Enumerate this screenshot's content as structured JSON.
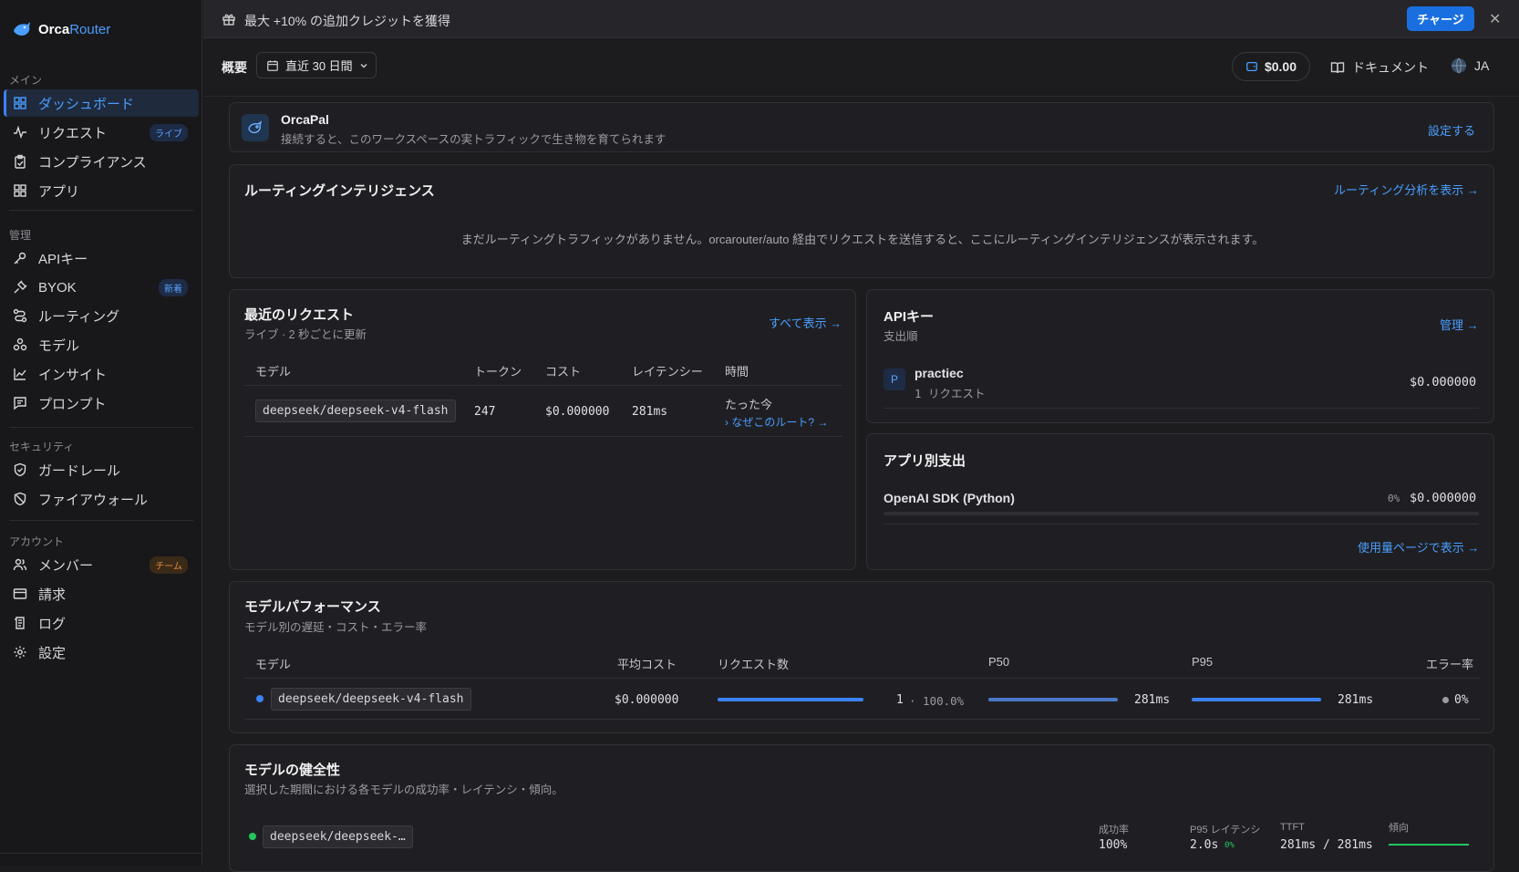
{
  "brand": {
    "name_a": "Orca",
    "name_b": "Router"
  },
  "sidebar": {
    "sections": {
      "main": "メイン",
      "manage": "管理",
      "security": "セキュリティ",
      "account": "アカウント"
    },
    "items": [
      {
        "label": "ダッシュボード",
        "icon": "grid-icon"
      },
      {
        "label": "リクエスト",
        "icon": "activity-icon",
        "badge": "ライブ"
      },
      {
        "label": "コンプライアンス",
        "icon": "clipboard-icon"
      },
      {
        "label": "アプリ",
        "icon": "apps-icon"
      },
      {
        "label": "APIキー",
        "icon": "key-icon"
      },
      {
        "label": "BYOK",
        "icon": "plug-icon",
        "badge": "新着"
      },
      {
        "label": "ルーティング",
        "icon": "route-icon"
      },
      {
        "label": "モデル",
        "icon": "models-icon"
      },
      {
        "label": "インサイト",
        "icon": "chart-icon"
      },
      {
        "label": "プロンプト",
        "icon": "message-icon"
      },
      {
        "label": "ガードレール",
        "icon": "shield-icon"
      },
      {
        "label": "ファイアウォール",
        "icon": "shield-off-icon"
      },
      {
        "label": "メンバー",
        "icon": "users-icon",
        "badge": "チーム"
      },
      {
        "label": "請求",
        "icon": "credit-card-icon"
      },
      {
        "label": "ログ",
        "icon": "log-icon"
      },
      {
        "label": "設定",
        "icon": "gear-icon"
      }
    ]
  },
  "banner": {
    "text": "最大 +10% の追加クレジットを獲得",
    "button": "チャージ"
  },
  "topbar": {
    "title": "概要",
    "date_range": "直近 30 日間",
    "balance": "$0.00",
    "docs": "ドキュメント",
    "lang": "JA"
  },
  "orcapal": {
    "title": "OrcaPal",
    "desc": "接続すると、このワークスペースの実トラフィックで生き物を育てられます",
    "action": "設定する"
  },
  "routing": {
    "title": "ルーティングインテリジェンス",
    "link": "ルーティング分析を表示 →",
    "empty": "まだルーティングトラフィックがありません。orcarouter/auto 経由でリクエストを送信すると、ここにルーティングインテリジェンスが表示されます。"
  },
  "recent": {
    "title": "最近のリクエスト",
    "sub": "ライブ · 2 秒ごとに更新",
    "link": "すべて表示 →",
    "headers": [
      "モデル",
      "トークン",
      "コスト",
      "レイテンシー",
      "時間"
    ],
    "rows": [
      {
        "model": "deepseek/deepseek-v4-flash",
        "tokens": "247",
        "cost": "$0.000000",
        "latency": "281ms",
        "time": "たった今",
        "why": "› なぜこのルート? →"
      }
    ]
  },
  "apikeys": {
    "title": "APIキー",
    "sub": "支出順",
    "link": "管理 →",
    "items": [
      {
        "initial": "P",
        "name": "practiec",
        "requests": "1 リクエスト",
        "cost": "$0.000000"
      }
    ]
  },
  "appspend": {
    "title": "アプリ別支出",
    "items": [
      {
        "name": "OpenAI SDK (Python)",
        "pct": "0%",
        "cost": "$0.000000",
        "share": 0
      }
    ],
    "link": "使用量ページで表示 →"
  },
  "perf": {
    "title": "モデルパフォーマンス",
    "sub": "モデル別の遅延・コスト・エラー率",
    "headers": [
      "モデル",
      "平均コスト",
      "リクエスト数",
      "P50",
      "P95",
      "エラー率"
    ],
    "rows": [
      {
        "model": "deepseek/deepseek-v4-flash",
        "avg_cost": "$0.000000",
        "requests": "1",
        "req_pct": "· 100.0%",
        "req_share": 1.0,
        "p50": "281ms",
        "p50_share": 1.0,
        "p95": "281ms",
        "p95_share": 1.0,
        "error": "0%"
      }
    ]
  },
  "health": {
    "title": "モデルの健全性",
    "sub": "選択した期間における各モデルの成功率・レイテンシ・傾向。",
    "headers": [
      "成功率",
      "P95 レイテンシ",
      "TTFT",
      "傾向"
    ],
    "rows": [
      {
        "model": "deepseek/deepseek-…",
        "success": "100%",
        "p95": "2.0s",
        "p95_delta": "0%",
        "ttft": "281ms / 281ms"
      }
    ]
  },
  "colors": {
    "accent": "#3b82f6",
    "link": "#4a9eff",
    "success": "#22c55e"
  }
}
